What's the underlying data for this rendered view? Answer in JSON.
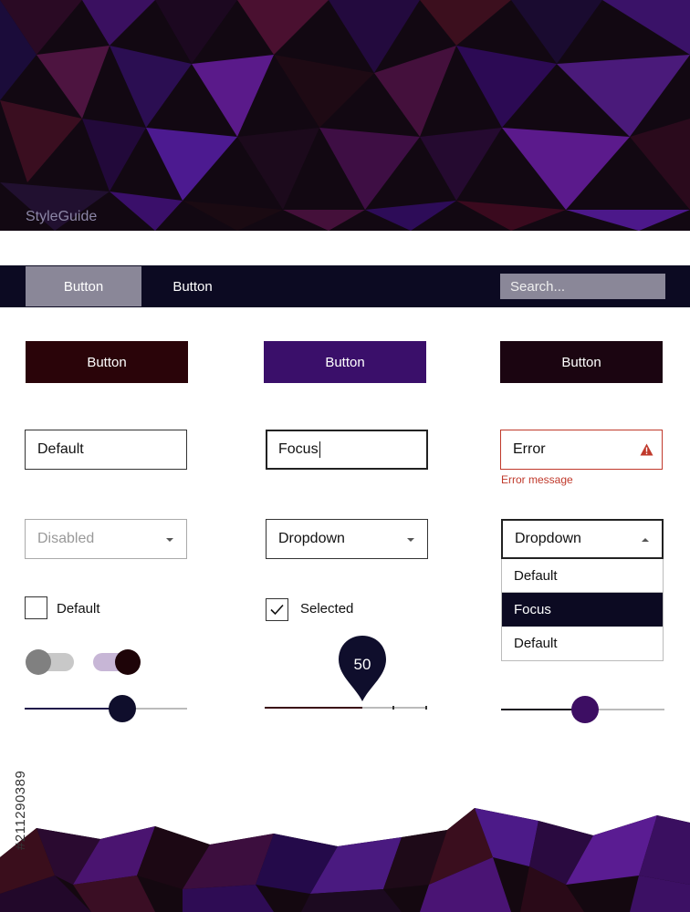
{
  "header": {
    "brand": "StyleGuide"
  },
  "navbar": {
    "button_1": "Button",
    "button_2": "Button",
    "search_placeholder": "Search..."
  },
  "buttons": [
    {
      "label": "Button",
      "color": "#2a0409"
    },
    {
      "label": "Button",
      "color": "#3a0f6a"
    },
    {
      "label": "Button",
      "color": "#1b0511"
    }
  ],
  "inputs": {
    "default_value": "Default",
    "focus_value": "Focus",
    "error_value": "Error",
    "error_message": "Error message"
  },
  "dropdowns": {
    "disabled_value": "Disabled",
    "dropdown_1_value": "Dropdown",
    "dropdown_2_value": "Dropdown",
    "options": [
      "Default",
      "Focus",
      "Default"
    ],
    "highlighted_index": 1
  },
  "checkboxes": {
    "default_label": "Default",
    "selected_label": "Selected",
    "selected_checked": true
  },
  "toggles": [
    {
      "state": "off"
    },
    {
      "state": "on"
    }
  ],
  "sliders": [
    {
      "value": 0.6,
      "thumb_color": "#0f0e2c",
      "track_color": "#20174a"
    },
    {
      "value": 50,
      "min": 0,
      "max": 100,
      "tooltip": "50",
      "thumb_color": "#0f0e2c"
    },
    {
      "value": 0.5,
      "thumb_color": "#3d0e63",
      "track_color": "#1a1520"
    }
  ],
  "watermark": "#211290389",
  "colors": {
    "navbar": "#0c0a22",
    "error": "#c0392b",
    "focus_option": "#0c0a22"
  }
}
